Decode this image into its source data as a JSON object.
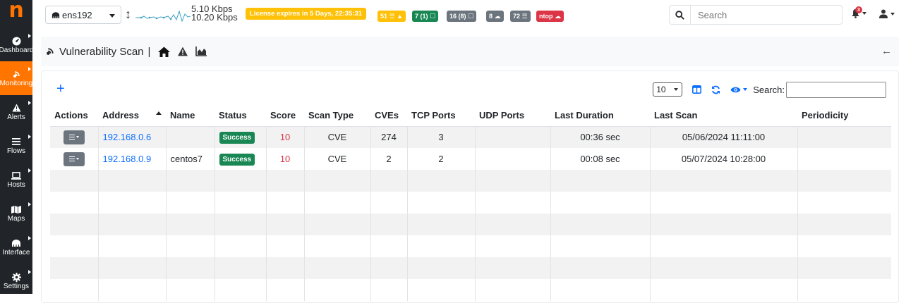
{
  "sidebar": {
    "brand": "n",
    "items": [
      {
        "label": "Dashboard",
        "icon": "dashboard-icon",
        "active": false
      },
      {
        "label": "Monitoring",
        "icon": "monitoring-icon",
        "active": true
      },
      {
        "label": "Alerts",
        "icon": "alert-icon",
        "active": false
      },
      {
        "label": "Flows",
        "icon": "flows-icon",
        "active": false
      },
      {
        "label": "Hosts",
        "icon": "laptop-icon",
        "active": false
      },
      {
        "label": "Maps",
        "icon": "map-icon",
        "active": false
      },
      {
        "label": "Interface",
        "icon": "ethernet-icon",
        "active": false
      },
      {
        "label": "Settings",
        "icon": "gear-icon",
        "active": false
      }
    ]
  },
  "topbar": {
    "interface": "ens192",
    "traffic_up": "5.10 Kbps",
    "traffic_down": "10.20 Kbps",
    "license": "License expires in 5 Days, 22:35:31",
    "badges": [
      {
        "text": "51 ☰ ▲",
        "color": "#ffc107"
      },
      {
        "text": "7 (1) ☐",
        "color": "#198754"
      },
      {
        "text": "16 (8) ☐",
        "color": "#6c757d"
      },
      {
        "text": "8 ☁",
        "color": "#6c757d"
      },
      {
        "text": "72 ☰",
        "color": "#6c757d"
      },
      {
        "text": "ntop ☁",
        "color": "#dc3545"
      }
    ],
    "search_placeholder": "Search",
    "notification_count": "3"
  },
  "breadcrumb": {
    "title": "Vulnerability Scan",
    "separator": "|"
  },
  "table": {
    "page_length": "10",
    "search_label": "Search:",
    "columns": [
      "Actions",
      "Address",
      "Name",
      "Status",
      "Score",
      "Scan Type",
      "CVEs",
      "TCP Ports",
      "UDP Ports",
      "Last Duration",
      "Last Scan",
      "Periodicity"
    ],
    "rows": [
      {
        "address": "192.168.0.6",
        "name": "",
        "status": "Success",
        "score": "10",
        "scan_type": "CVE",
        "cves": "274",
        "tcp_ports": "3",
        "udp_ports": "",
        "last_duration": "00:36 sec",
        "last_scan": "05/06/2024 11:11:00",
        "periodicity": ""
      },
      {
        "address": "192.168.0.9",
        "name": "centos7",
        "status": "Success",
        "score": "10",
        "scan_type": "CVE",
        "cves": "2",
        "tcp_ports": "2",
        "udp_ports": "",
        "last_duration": "00:08 sec",
        "last_scan": "05/07/2024 10:28:00",
        "periodicity": ""
      }
    ]
  },
  "colors": {
    "brand": "#ff7500",
    "sidebar_bg": "#212529",
    "link": "#0d6efd",
    "success": "#198754",
    "danger": "#dc3545",
    "warning": "#ffc107"
  }
}
